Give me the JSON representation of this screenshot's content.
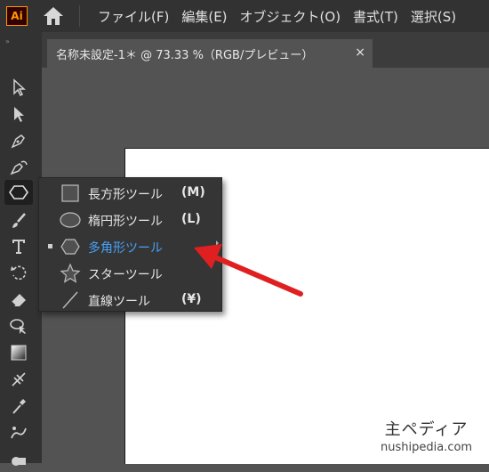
{
  "app": {
    "logo_text": "Ai",
    "accent": "#ff9a00"
  },
  "menubar": {
    "items": [
      "ファイル(F)",
      "編集(E)",
      "オブジェクト(O)",
      "書式(T)",
      "選択(S)"
    ]
  },
  "document_tab": {
    "title": "名称未設定-1＊ @ 73.33 %（RGB/プレビュー）",
    "close_glyph": "×"
  },
  "toolbar": {
    "grip": "»",
    "tools": [
      "selection-tool-icon",
      "direct-selection-tool-icon",
      "pen-tool-icon",
      "curvature-tool-icon",
      "polygon-tool-icon",
      "paintbrush-tool-icon",
      "type-tool-icon",
      "rotate-tool-icon",
      "eraser-tool-icon",
      "lasso-tool-icon",
      "gradient-tool-icon",
      "eyedropper-tool-icon",
      "symbol-sprayer-tool-icon"
    ],
    "active_tool": "polygon-tool-icon"
  },
  "flyout": {
    "items": [
      {
        "label": "長方形ツール",
        "shortcut": "(M)",
        "icon": "rectangle-icon"
      },
      {
        "label": "楕円形ツール",
        "shortcut": "(L)",
        "icon": "ellipse-icon"
      },
      {
        "label": "多角形ツール",
        "shortcut": "",
        "icon": "polygon-icon",
        "selected": true
      },
      {
        "label": "スターツール",
        "shortcut": "",
        "icon": "star-icon"
      },
      {
        "label": "直線ツール",
        "shortcut": "(¥)",
        "icon": "line-icon"
      }
    ],
    "selected_color": "#46a0f5"
  },
  "annotation": {
    "arrow_color": "#e02020"
  },
  "watermark": {
    "main": "主ペディア",
    "sub": "nushipedia.com"
  }
}
